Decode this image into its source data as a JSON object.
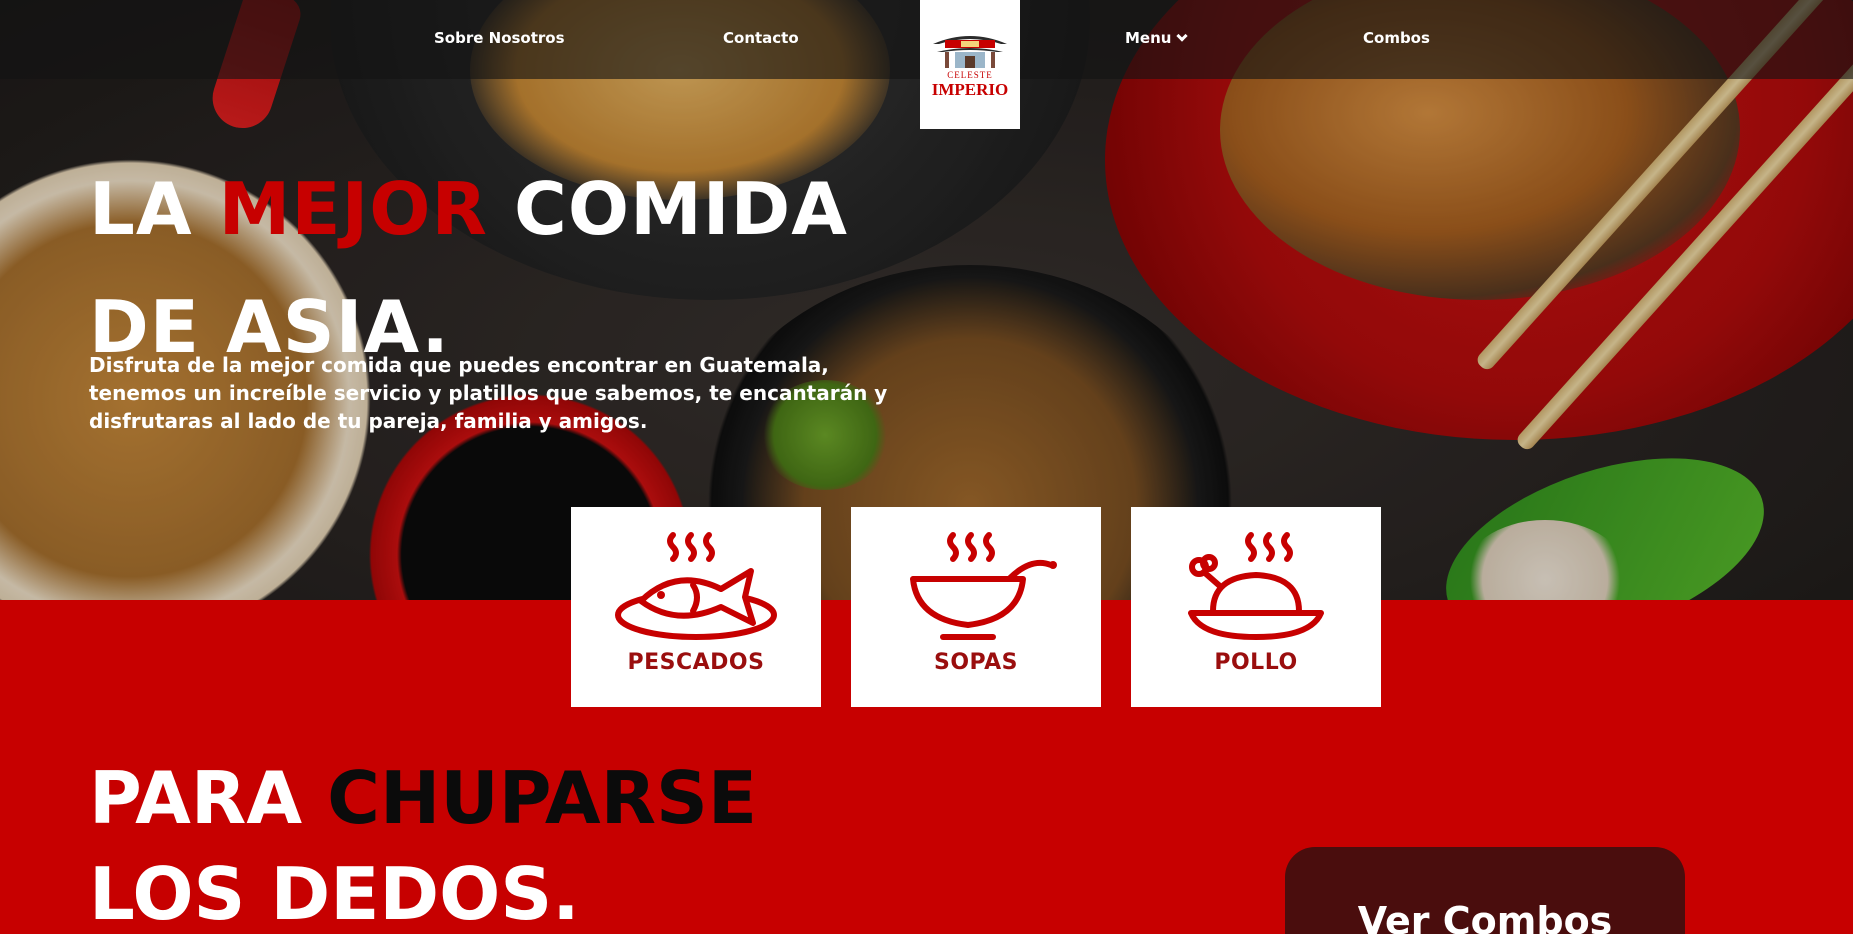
{
  "nav": {
    "links": [
      "Sobre Nosotros",
      "Contacto",
      "Menu",
      "Combos"
    ],
    "menu_icon": "chevron-down-icon"
  },
  "logo": {
    "subtitle": "CELESTE",
    "name": "IMPERIO"
  },
  "hero": {
    "title_part1": "LA ",
    "title_accent": "MEJOR",
    "title_part2": " COMIDA DE ASIA.",
    "description": "Disfruta de la mejor comida que puedes encontrar en Guatemala, tenemos un increíble servicio y platillos que sabemos, te encantarán y disfrutaras al lado de tu pareja, familia y amigos."
  },
  "categories": [
    {
      "label": "PESCADOS",
      "icon": "fish-dish-icon"
    },
    {
      "label": "SOPAS",
      "icon": "soup-bowl-icon"
    },
    {
      "label": "POLLO",
      "icon": "chicken-dish-icon"
    }
  ],
  "section2": {
    "title_part1": "PARA ",
    "title_accent": "CHUPARSE",
    "title_part2": "LOS DEDOS.",
    "button_label": "Ver Combos"
  },
  "colors": {
    "accent": "#c70000",
    "dark_button": "#4a0d0d",
    "card_label": "#9a0e0e"
  }
}
